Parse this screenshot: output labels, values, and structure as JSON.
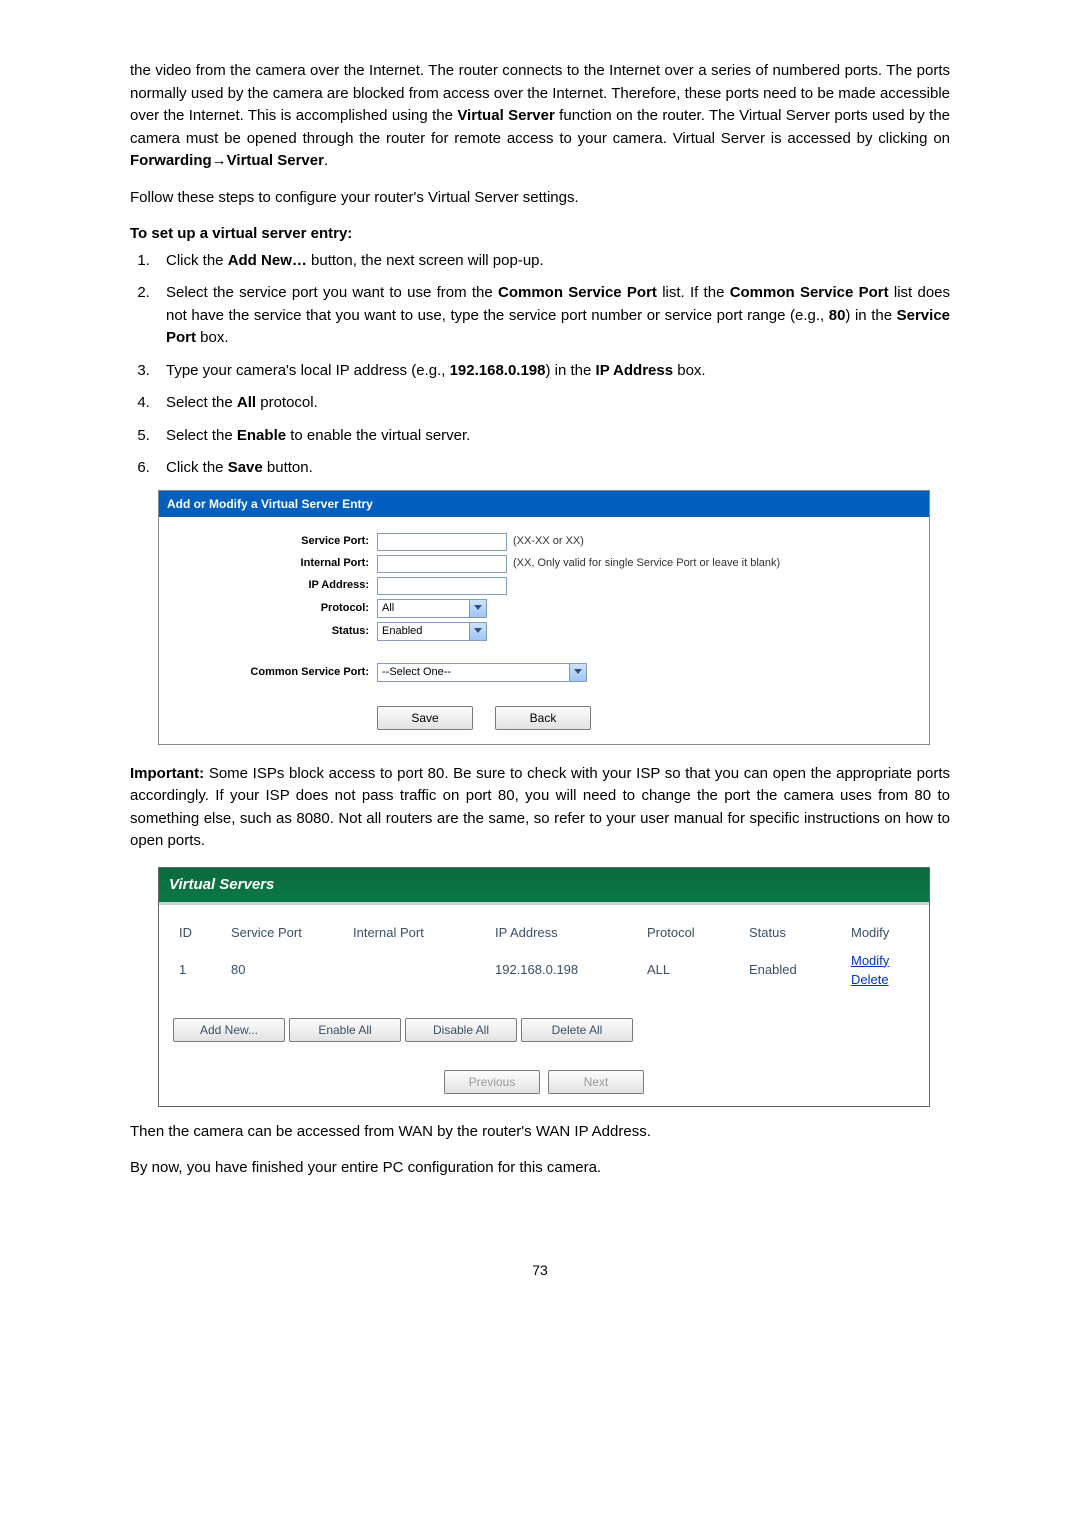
{
  "intro_paragraph": "the video from the camera over the Internet. The router connects to the Internet over a series of numbered ports. The ports normally used by the camera are blocked from access over the Internet. Therefore, these ports need to be made accessible over the Internet. This is accomplished using the ",
  "intro_bold1": "Virtual Server",
  "intro_mid": " function on the router. The Virtual Server ports used by the camera must be opened through the router for remote access to your camera. Virtual Server is accessed by clicking on ",
  "intro_bold2": "Forwarding→Virtual Server",
  "intro_end": ".",
  "follow_steps": "Follow these steps to configure your router's Virtual Server settings.",
  "setup_heading": "To set up a virtual server entry:",
  "steps": {
    "s1_a": "Click the ",
    "s1_b": "Add New…",
    "s1_c": " button, the next screen will pop-up.",
    "s2_a": "Select the service port you want to use from the ",
    "s2_b": "Common Service Port",
    "s2_c": " list. If the ",
    "s2_d": "Common Service Port",
    "s2_e": " list does not have the service that you want to use, type the service port number or service port range (e.g., ",
    "s2_f": "80",
    "s2_g": ") in the ",
    "s2_h": "Service Port",
    "s2_i": " box.",
    "s3_a": "Type your camera's local IP address (e.g., ",
    "s3_b": "192.168.0.198",
    "s3_c": ") in the ",
    "s3_d": "IP Address",
    "s3_e": " box.",
    "s4_a": "Select the ",
    "s4_b": "All",
    "s4_c": " protocol.",
    "s5_a": "Select the ",
    "s5_b": "Enable",
    "s5_c": " to enable the virtual server.",
    "s6_a": "Click the ",
    "s6_b": "Save",
    "s6_c": " button."
  },
  "panel1": {
    "title": "Add or Modify a Virtual Server Entry",
    "labels": {
      "service_port": "Service Port:",
      "internal_port": "Internal Port:",
      "ip_address": "IP Address:",
      "protocol": "Protocol:",
      "status": "Status:",
      "common_service_port": "Common Service Port:"
    },
    "hints": {
      "service_port": "(XX-XX or XX)",
      "internal_port": "(XX, Only valid for single Service Port or leave it blank)"
    },
    "protocol_value": "All",
    "status_value": "Enabled",
    "common_service_value": "--Select One--",
    "buttons": {
      "save": "Save",
      "back": "Back"
    }
  },
  "important": {
    "label": "Important:",
    "text": "  Some ISPs block access to port 80. Be sure to check with your ISP so that you can open the appropriate ports accordingly. If your ISP does not pass traffic on port 80, you will need to change the port the camera uses from 80 to something else, such as 8080. Not all routers are the same, so refer to your user manual for specific instructions on how to open ports."
  },
  "panel2": {
    "title": "Virtual Servers",
    "headers": {
      "id": "ID",
      "service_port": "Service Port",
      "internal_port": "Internal Port",
      "ip_address": "IP Address",
      "protocol": "Protocol",
      "status": "Status",
      "modify": "Modify"
    },
    "row": {
      "id": "1",
      "service_port": "80",
      "internal_port": "",
      "ip_address": "192.168.0.198",
      "protocol": "ALL",
      "status": "Enabled",
      "modify": "Modify",
      "delete": "Delete"
    },
    "buttons": {
      "add_new": "Add New...",
      "enable_all": "Enable All",
      "disable_all": "Disable All",
      "delete_all": "Delete All",
      "previous": "Previous",
      "next": "Next"
    }
  },
  "after1": "Then the camera can be accessed from WAN by the router's WAN IP Address.",
  "after2": "By now, you have finished your entire PC configuration for this camera.",
  "page_number": "73"
}
